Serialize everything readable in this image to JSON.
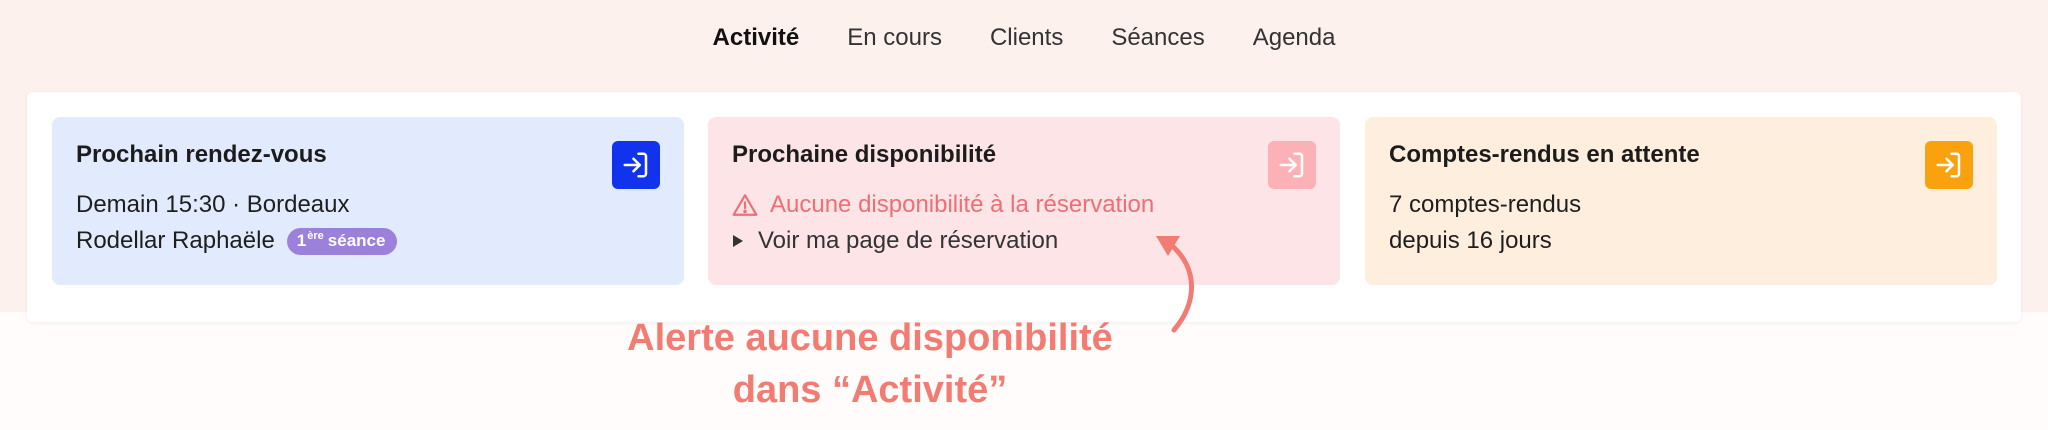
{
  "nav": {
    "items": [
      {
        "label": "Activité",
        "active": true
      },
      {
        "label": "En cours",
        "active": false
      },
      {
        "label": "Clients",
        "active": false
      },
      {
        "label": "Séances",
        "active": false
      },
      {
        "label": "Agenda",
        "active": false
      }
    ]
  },
  "cards": {
    "next_appointment": {
      "title": "Prochain rendez-vous",
      "line1": "Demain 15:30 · Bordeaux",
      "client": "Rodellar Raphaële",
      "badge_number": "1",
      "badge_sup": "ère",
      "badge_word": "séance",
      "button_icon": "sign-in-icon"
    },
    "next_availability": {
      "title": "Prochaine disponibilité",
      "alert": "Aucune disponibilité à la réservation",
      "link": "Voir ma page de réservation",
      "alert_icon": "warning-triangle-icon",
      "button_icon": "sign-in-icon"
    },
    "pending_reports": {
      "title": "Comptes-rendus en attente",
      "line1": "7 comptes-rendus",
      "line2": "depuis 16 jours",
      "button_icon": "sign-in-icon"
    }
  },
  "annotation": {
    "line1": "Alerte aucune disponibilité",
    "line2": "dans “Activité”"
  },
  "colors": {
    "background_top": "#fdf1ee",
    "card_blue": "#e1ebfd",
    "card_pink": "#fde4e6",
    "card_orange": "#feeede",
    "button_blue": "#1133ee",
    "button_pink": "#fbb1b5",
    "button_orange": "#f9a20e",
    "badge": "#9b80dc",
    "alert": "#ee6e76",
    "annotation": "#f27b72"
  }
}
